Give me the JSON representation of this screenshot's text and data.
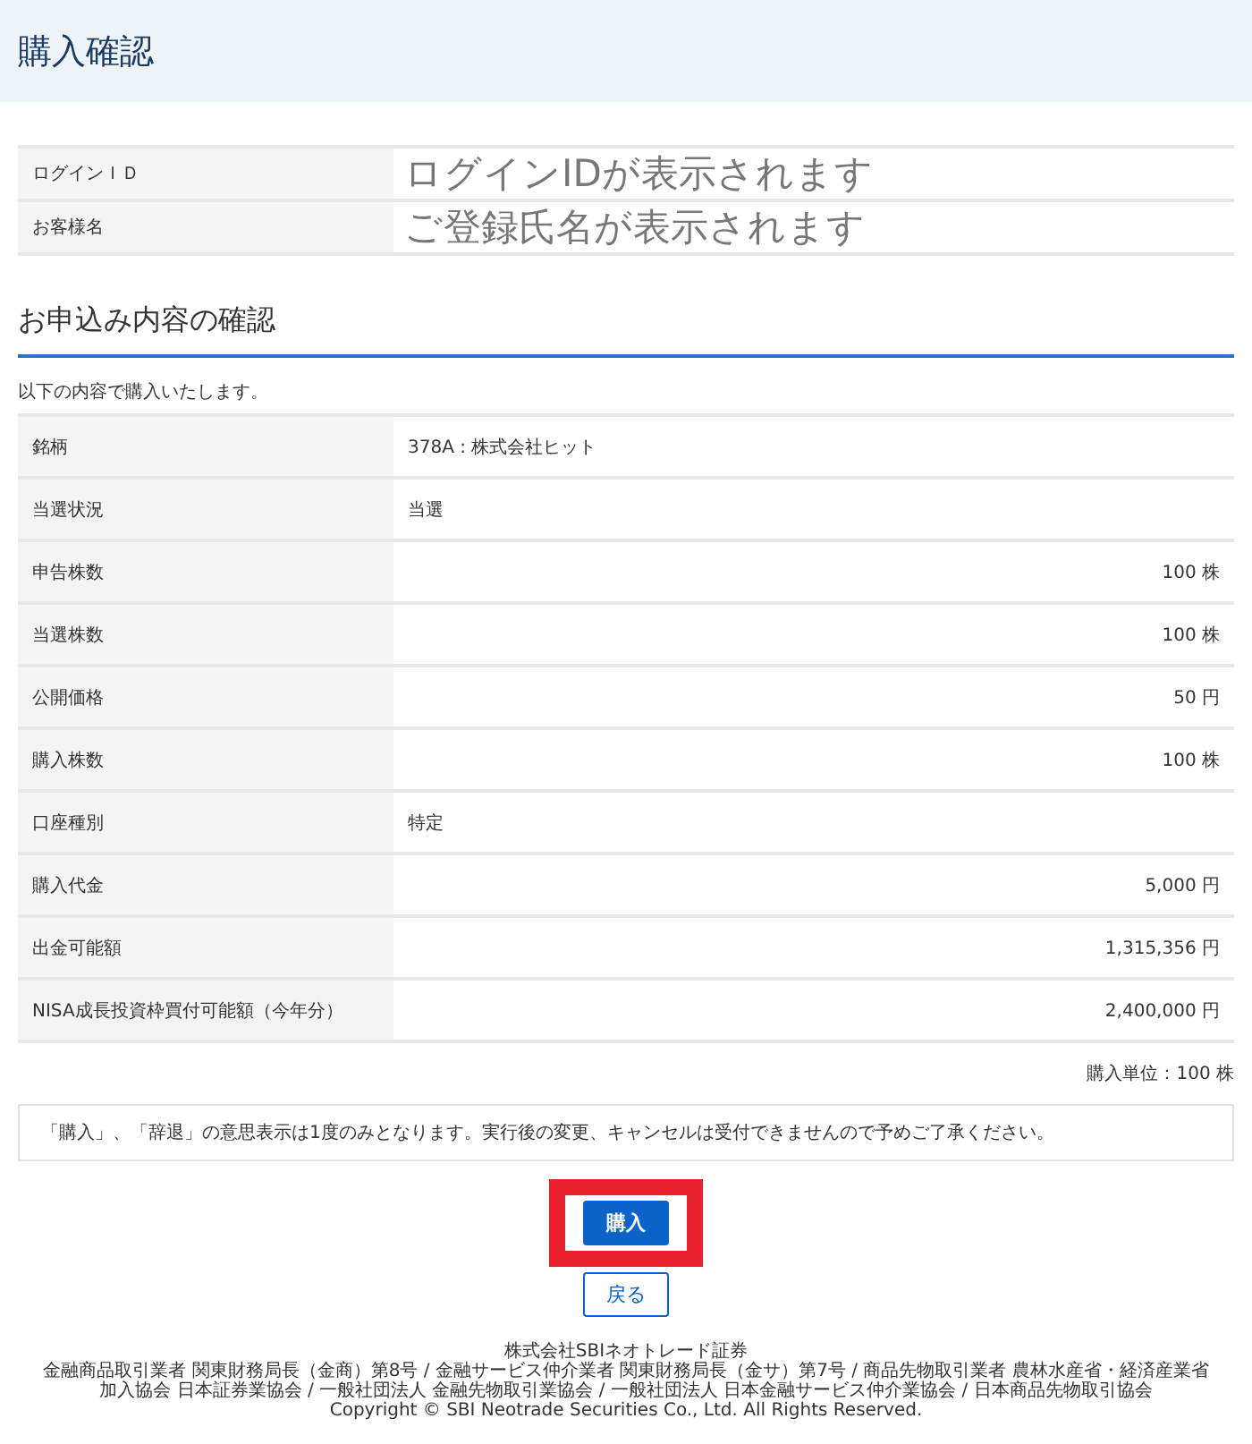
{
  "page_title": "購入確認",
  "account": [
    {
      "label": "ログインＩＤ",
      "value": "ログインIDが表示されます"
    },
    {
      "label": "お客様名",
      "value": "ご登録氏名が表示されます"
    }
  ],
  "section_title": "お申込み内容の確認",
  "intro": "以下の内容で購入いたします。",
  "details": [
    {
      "label": "銘柄",
      "value": "378A : 株式会社ヒット",
      "kind": "text"
    },
    {
      "label": "当選状況",
      "value": "当選",
      "kind": "text"
    },
    {
      "label": "申告株数",
      "value": "100 株",
      "kind": "amount"
    },
    {
      "label": "当選株数",
      "value": "100 株",
      "kind": "amount"
    },
    {
      "label": "公開価格",
      "value": "50 円",
      "kind": "amount"
    },
    {
      "label": "購入株数",
      "value": "100 株",
      "kind": "amount"
    },
    {
      "label": "口座種別",
      "value": "特定",
      "kind": "text"
    },
    {
      "label": "購入代金",
      "value": "5,000 円",
      "kind": "amount"
    },
    {
      "label": "出金可能額",
      "value": "1,315,356 円",
      "kind": "amount"
    },
    {
      "label": "NISA成長投資枠買付可能額（今年分）",
      "value": "2,400,000 円",
      "kind": "amount"
    }
  ],
  "unit_note": "購入単位：100 株",
  "notice": "「購入」、「辞退」の意思表示は1度のみとなります。実行後の変更、キャンセルは受付できませんので予めご了承ください。",
  "buttons": [
    {
      "label": "購入",
      "kind": "primary",
      "highlighted": true
    },
    {
      "label": "戻る",
      "kind": "secondary",
      "highlighted": false
    }
  ],
  "footer": [
    "株式会社SBIネオトレード証券",
    "金融商品取引業者 関東財務局長（金商）第8号 / 金融サービス仲介業者 関東財務局長（金サ）第7号 / 商品先物取引業者 農林水産省・経済産業省",
    "加入協会 日本証券業協会 / 一般社団法人 金融先物取引業協会 / 一般社団法人 日本金融サービス仲介業協会 / 日本商品先物取引協会",
    "Copyright © SBI Neotrade Securities Co., Ltd. All Rights Reserved."
  ]
}
